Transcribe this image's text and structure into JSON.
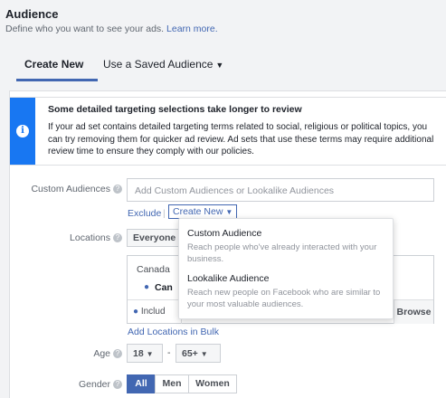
{
  "header": {
    "title": "Audience",
    "subtitle": "Define who you want to see your ads.",
    "learn_more": "Learn more."
  },
  "tabs": [
    {
      "label": "Create New",
      "active": true
    },
    {
      "label": "Use a Saved Audience",
      "active": false
    }
  ],
  "notice": {
    "title": "Some detailed targeting selections take longer to review",
    "body": "If your ad set contains detailed targeting terms related to social, religious or political topics, you can try removing them for quicker ad review. Ad sets that use these terms may require additional review time to ensure they comply with our policies."
  },
  "custom_audiences": {
    "label": "Custom Audiences",
    "placeholder": "Add Custom Audiences or Lookalike Audiences",
    "exclude": "Exclude",
    "create_new": "Create New"
  },
  "dropdown": {
    "items": [
      {
        "title": "Custom Audience",
        "desc": "Reach people who've already interacted with your business."
      },
      {
        "title": "Lookalike Audience",
        "desc": "Reach new people on Facebook who are similar to your most valuable audiences."
      }
    ]
  },
  "locations": {
    "label": "Locations",
    "selected": "Everyone",
    "country": "Canada",
    "location_name": "Can",
    "include": "Includ",
    "browse": "Browse",
    "add_bulk": "Add Locations in Bulk"
  },
  "age": {
    "label": "Age",
    "min": "18",
    "max": "65+"
  },
  "gender": {
    "label": "Gender",
    "options": [
      "All",
      "Men",
      "Women"
    ],
    "selected": "All"
  },
  "colors": {
    "accent": "#4267b2",
    "info_bar": "#1877f2",
    "background": "#f2f3f5"
  }
}
